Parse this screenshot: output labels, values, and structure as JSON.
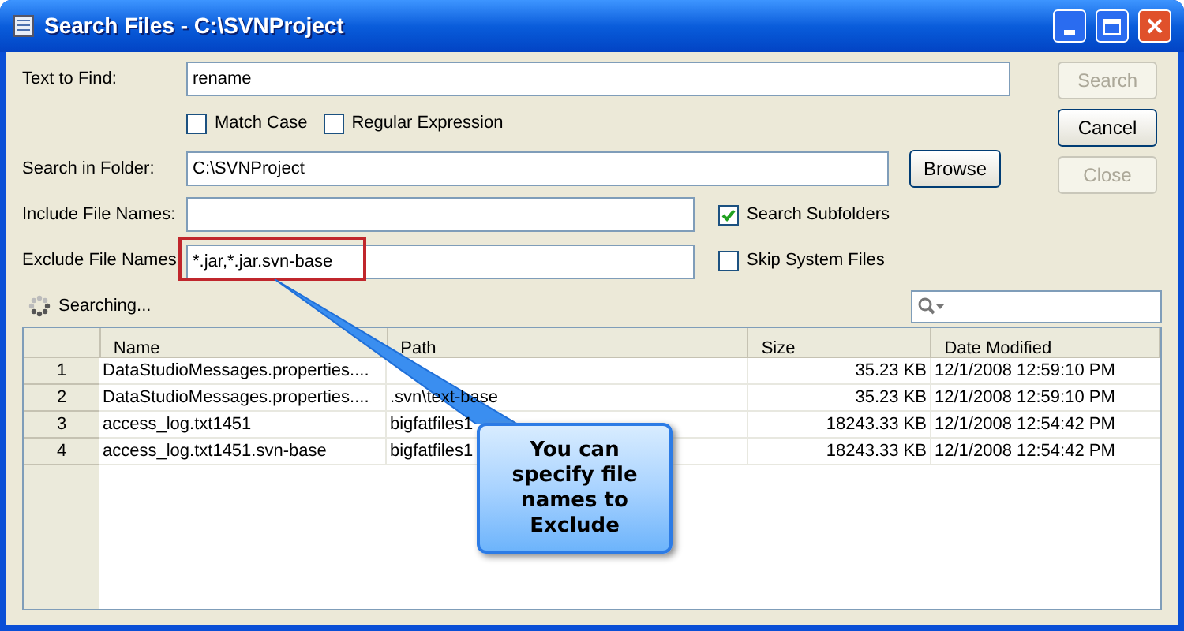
{
  "window": {
    "title": "Search Files - C:\\SVNProject"
  },
  "fields": [
    {
      "label": "Text to Find:",
      "value": "rename"
    },
    {
      "label": "Search in Folder:",
      "value": "C:\\SVNProject"
    },
    {
      "label": "Include File Names:"
    },
    {
      "label": "Exclude File Names:",
      "value": "*.jar,*.jar.svn-base",
      "highlighted": true
    }
  ],
  "options": [
    {
      "label": "Match Case",
      "checked": false
    },
    {
      "label": "Regular Expression",
      "checked": false
    },
    {
      "label": "Search Subfolders",
      "checked": true
    },
    {
      "label": "Skip System Files",
      "checked": false
    }
  ],
  "buttons": [
    {
      "label": "Search",
      "disabled": true
    },
    {
      "label": "Cancel",
      "disabled": false
    },
    {
      "label": "Browse",
      "disabled": false
    },
    {
      "label": "Close",
      "disabled": true
    }
  ],
  "status": "Searching...",
  "table": {
    "columns": [
      "Name",
      "Path",
      "Size",
      "Date Modified"
    ],
    "rows": [
      {
        "num": "1",
        "name": "DataStudioMessages.properties....",
        "size": "35.23 KB",
        "date": "12/1/2008 12:59:10 PM"
      },
      {
        "num": "2",
        "name": "DataStudioMessages.properties....",
        "path": ".svn\\text-base",
        "size": "35.23 KB",
        "date": "12/1/2008 12:59:10 PM"
      },
      {
        "num": "3",
        "name": "access_log.txt1451",
        "path": "bigfatfiles1",
        "size": "18243.33 KB",
        "date": "12/1/2008 12:54:42 PM"
      },
      {
        "num": "4",
        "name": "access_log.txt1451.svn-base",
        "path": "bigfatfiles1",
        "size": "18243.33 KB",
        "date": "12/1/2008 12:54:42 PM"
      }
    ]
  },
  "callout": {
    "text": "You can specify file names to Exclude"
  }
}
